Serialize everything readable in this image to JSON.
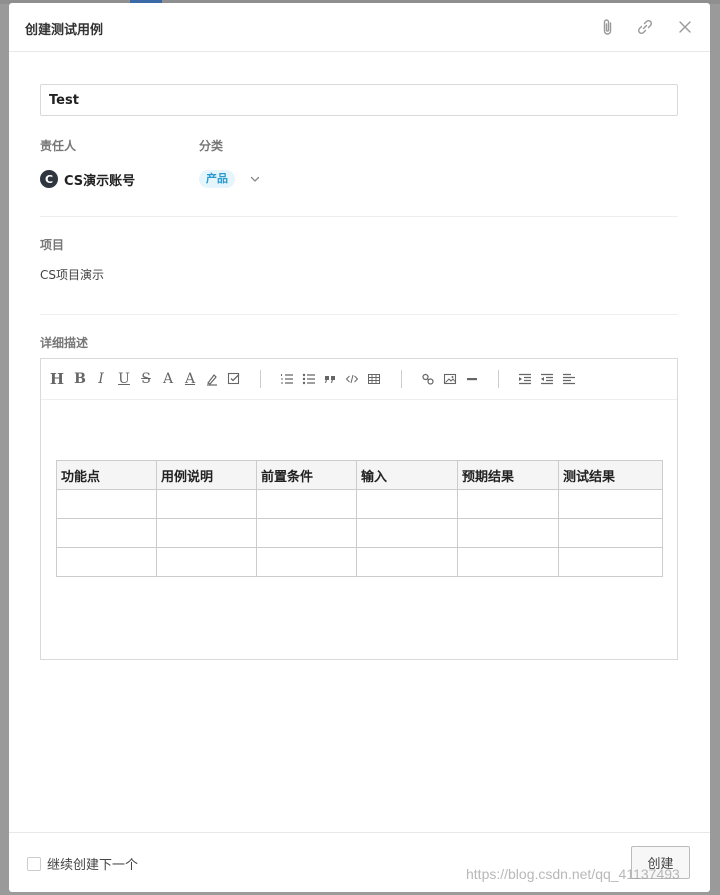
{
  "modal": {
    "title": "创建测试用例"
  },
  "form": {
    "title_value": "Test",
    "assignee_label": "责任人",
    "assignee_initial": "C",
    "assignee_name": "CS演示账号",
    "category_label": "分类",
    "category_value": "产品",
    "project_label": "项目",
    "project_value": "CS项目演示",
    "description_label": "详细描述"
  },
  "toolbar": {
    "heading": "H",
    "bold": "B",
    "italic": "I",
    "underline": "U",
    "strike": "S",
    "font_size": "A",
    "font_color": "A"
  },
  "table": {
    "headers": [
      "功能点",
      "用例说明",
      "前置条件",
      "输入",
      "预期结果",
      "测试结果"
    ],
    "rows": [
      [
        "",
        "",
        "",
        "",
        "",
        ""
      ],
      [
        "",
        "",
        "",
        "",
        "",
        ""
      ],
      [
        "",
        "",
        "",
        "",
        "",
        ""
      ]
    ]
  },
  "footer": {
    "continue_label": "继续创建下一个",
    "create_label": "创建"
  },
  "watermark": "https://blog.csdn.net/qq_41137493",
  "colors": {
    "tag_bg": "#e6f4fb",
    "tag_text": "#2a9bd0",
    "avatar_bg": "#2f3640"
  },
  "icons": [
    "paperclip-icon",
    "link-icon",
    "close-icon",
    "chevron-down-icon"
  ]
}
